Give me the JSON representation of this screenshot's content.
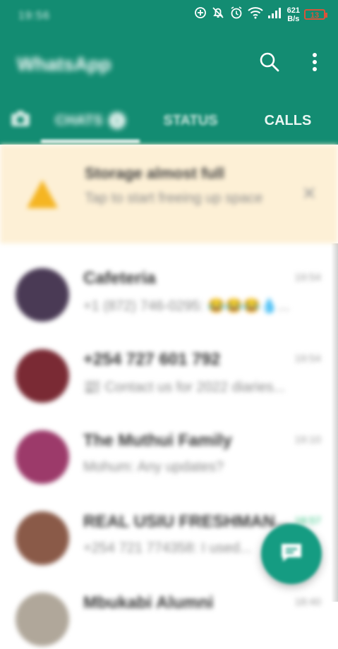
{
  "colors": {
    "header": "#138c72",
    "accent": "#159c82",
    "banner": "#fdf0d6",
    "warning": "#f5b522"
  },
  "status_bar": {
    "time": "19:56",
    "speed_value": "621",
    "speed_unit": "B/s",
    "battery": "13"
  },
  "app": {
    "title": "WhatsApp"
  },
  "tabs": {
    "chats": "CHATS",
    "chats_badge": "1",
    "status": "STATUS",
    "calls": "CALLS"
  },
  "banner": {
    "title": "Storage almost full",
    "text": "Tap to start freeing up space"
  },
  "chats": [
    {
      "name": "Cafeteria",
      "time": "19:54",
      "preview": "+1 (872) 746-0295: 😂😂😂💧...",
      "avatar_color": "#4a3a55"
    },
    {
      "name": "+254 727 601 792",
      "time": "19:54",
      "preview": "📰 Contact us for 2022 diaries...",
      "avatar_color": "#7a2a34"
    },
    {
      "name": "The Muthui Family",
      "time": "19:10",
      "preview": "Mohum: Any updates?",
      "avatar_color": "#9c3a6a"
    },
    {
      "name": "REAL USIU FRESHMAN...",
      "time": "18:57",
      "preview": "+254 721 774358: I used...",
      "avatar_color": "#8a5a48"
    },
    {
      "name": "Mbukabi Alumni",
      "time": "18:40",
      "preview": "",
      "avatar_color": "#b0a79a"
    }
  ]
}
